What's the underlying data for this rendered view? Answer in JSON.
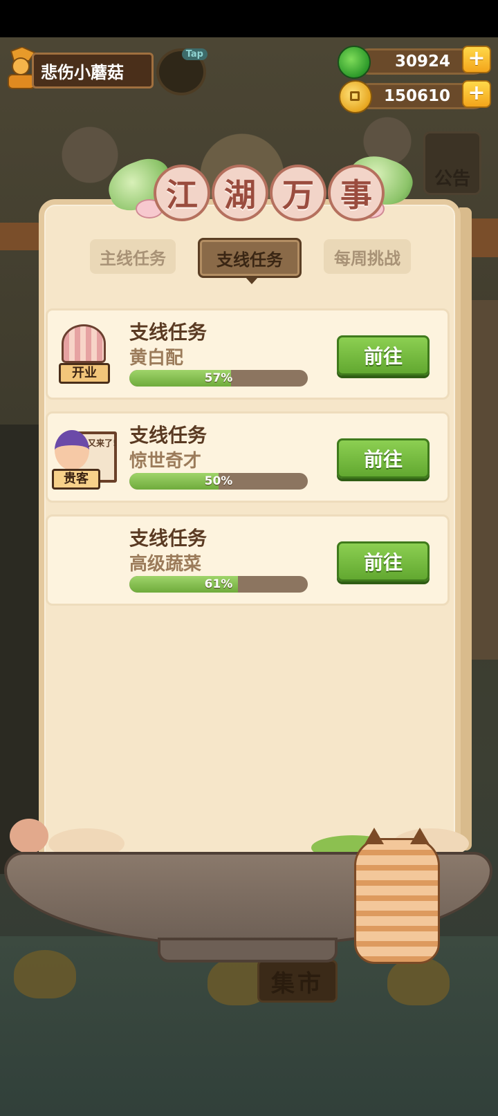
{
  "hud": {
    "player_name": "悲伤小蘑菇",
    "tap_label": "Tap",
    "jade_amount": "30924",
    "coin_amount": "150610",
    "plus_label": "+"
  },
  "background": {
    "notice_label": "公告",
    "market_label": "集市"
  },
  "panel": {
    "title_chars": [
      "江",
      "湖",
      "万",
      "事"
    ],
    "tabs": [
      {
        "label": "主线任务",
        "active": false
      },
      {
        "label": "支线任务",
        "active": true
      },
      {
        "label": "每周挑战",
        "active": false
      }
    ],
    "tasks": [
      {
        "name": "支线任务",
        "subtitle": "黄白配",
        "progress": 0.57,
        "progress_text": "57%",
        "button": "前往",
        "badge": "开业",
        "icon": "shop-icon"
      },
      {
        "name": "支线任务",
        "subtitle": "惊世奇才",
        "progress": 0.5,
        "progress_text": "50%",
        "button": "前往",
        "badge": "贵客",
        "icon": "guest-icon",
        "bubble": "又来了!"
      },
      {
        "name": "支线任务",
        "subtitle": "高级蔬菜",
        "progress": 0.61,
        "progress_text": "61%",
        "button": "前往",
        "badge": "",
        "icon": ""
      }
    ]
  },
  "colors": {
    "accent_green": "#6fab3c",
    "panel_bg": "#f6e6c9",
    "title_red": "#9a4c3e"
  }
}
